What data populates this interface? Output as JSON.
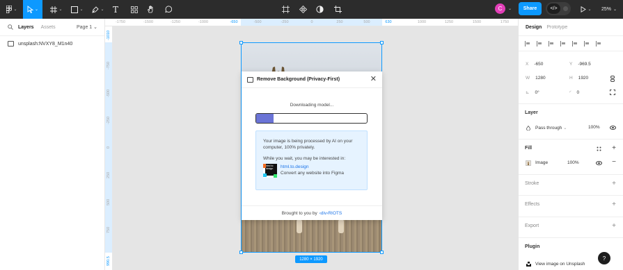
{
  "toolbar": {
    "tools": [
      "figma-menu",
      "move",
      "frame",
      "shape",
      "pen",
      "text",
      "resources",
      "hand",
      "comment"
    ],
    "text_tool_glyph": "T",
    "avatar_initial": "C",
    "share_label": "Share",
    "dev_mode_glyph": "</>",
    "zoom": "25%",
    "accent_color": "#0d99ff"
  },
  "left_panel": {
    "tabs": [
      "Layers",
      "Assets"
    ],
    "page_selector": "Page 1",
    "layers": [
      {
        "name": "unsplash:NVXY8_M1n40",
        "icon": "image-icon"
      }
    ]
  },
  "rulers": {
    "top": [
      "-1750",
      "-1500",
      "-1250",
      "-1000",
      "-650",
      "-500",
      "-250",
      "0",
      "250",
      "500",
      "630",
      "1000",
      "1250",
      "1500",
      "1750"
    ],
    "left": [
      "-1010",
      "-750",
      "-500",
      "-250",
      "0",
      "250",
      "500",
      "750",
      "990.5"
    ],
    "selection_top": [
      "-650",
      "630"
    ],
    "selection_left": [
      "-1010",
      "990.5"
    ]
  },
  "canvas": {
    "selection_size": "1280 × 1920"
  },
  "plugin": {
    "title": "Remove Background (Privacy-First)",
    "status": "Downloading model...",
    "progress_fraction": 0.16,
    "progress_color": "#6b74d6",
    "info_text": "Your image is being processed by AI on your computer, 100% privately.",
    "interest_text": "While you wait, you may be interested in:",
    "promo_logo_text": "html to design",
    "promo_link": "html.to.design",
    "promo_desc": "Convert any website into Figma",
    "footer_prefix": "Brought to you by",
    "footer_brand": "‹div›RIOTS",
    "close_glyph": "✕"
  },
  "right_panel": {
    "tabs": [
      "Design",
      "Prototype"
    ],
    "x_label": "X",
    "x_value": "-650",
    "y_label": "Y",
    "y_value": "-969.5",
    "w_label": "W",
    "w_value": "1280",
    "h_label": "H",
    "h_value": "1920",
    "rotation_label": "⊾",
    "rotation_value": "0°",
    "radius_label": "◜",
    "radius_value": "0",
    "layer": {
      "title": "Layer",
      "blend": "Pass through",
      "opacity": "100%"
    },
    "fill": {
      "title": "Fill",
      "type": "Image",
      "opacity": "100%"
    },
    "stroke_title": "Stroke",
    "effects_title": "Effects",
    "export_title": "Export",
    "plugin_title": "Plugin",
    "plugin_link": "View image on Unsplash"
  },
  "help_glyph": "?"
}
